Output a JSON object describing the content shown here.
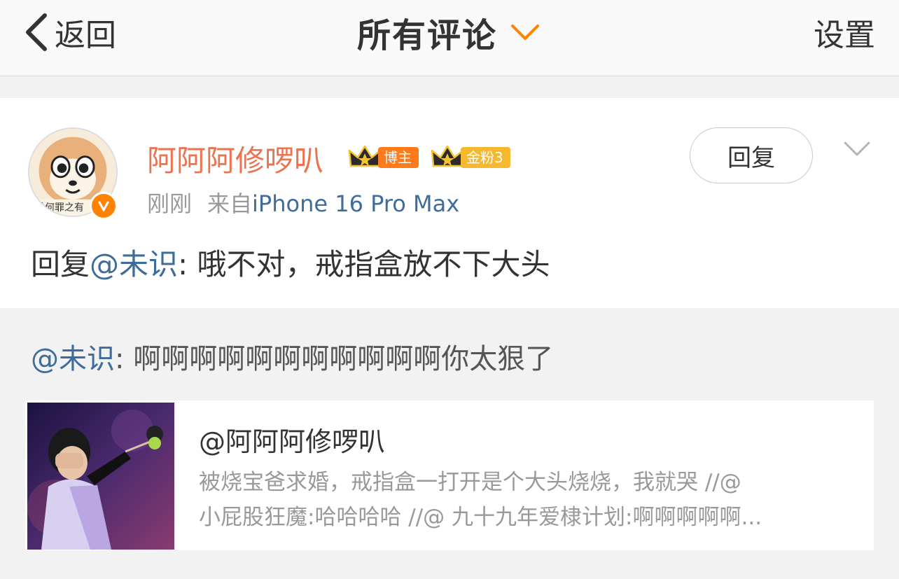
{
  "nav": {
    "back_label": "返回",
    "title": "所有评论",
    "settings_label": "设置"
  },
  "comment": {
    "username": "阿阿阿修啰叭",
    "badges": {
      "blogger": "博主",
      "fans": "金粉3"
    },
    "time": "刚刚",
    "source_prefix": "来自",
    "source": "iPhone 16 Pro Max",
    "reply_button": "回复",
    "text_prefix": "回复",
    "mention": "@未识",
    "text_body": ": 哦不对，戒指盒放不下大头",
    "avatar_caption": "羊何罪之有"
  },
  "quote": {
    "mention": "@未识",
    "text": ": 啊啊啊啊啊啊啊啊啊啊啊你太狠了",
    "original": {
      "author": "@阿阿阿修啰叭",
      "line1": "被烧宝爸求婚，戒指盒一打开是个大头烧烧，我就哭 //@",
      "line2": "小屁股狂魔:哈哈哈哈 //@ 九十九年爱棣计划:啊啊啊啊啊..."
    }
  },
  "colors": {
    "username": "#eb7350",
    "link": "#3e6c9b",
    "accent_orange": "#ff8200",
    "fans_badge": "#f5b82e"
  },
  "icons": {
    "back": "chevron-left-icon",
    "title_dropdown": "chevron-down-icon",
    "more": "chevron-down-icon",
    "verified": "verified-v-icon",
    "crown": "crown-icon"
  }
}
